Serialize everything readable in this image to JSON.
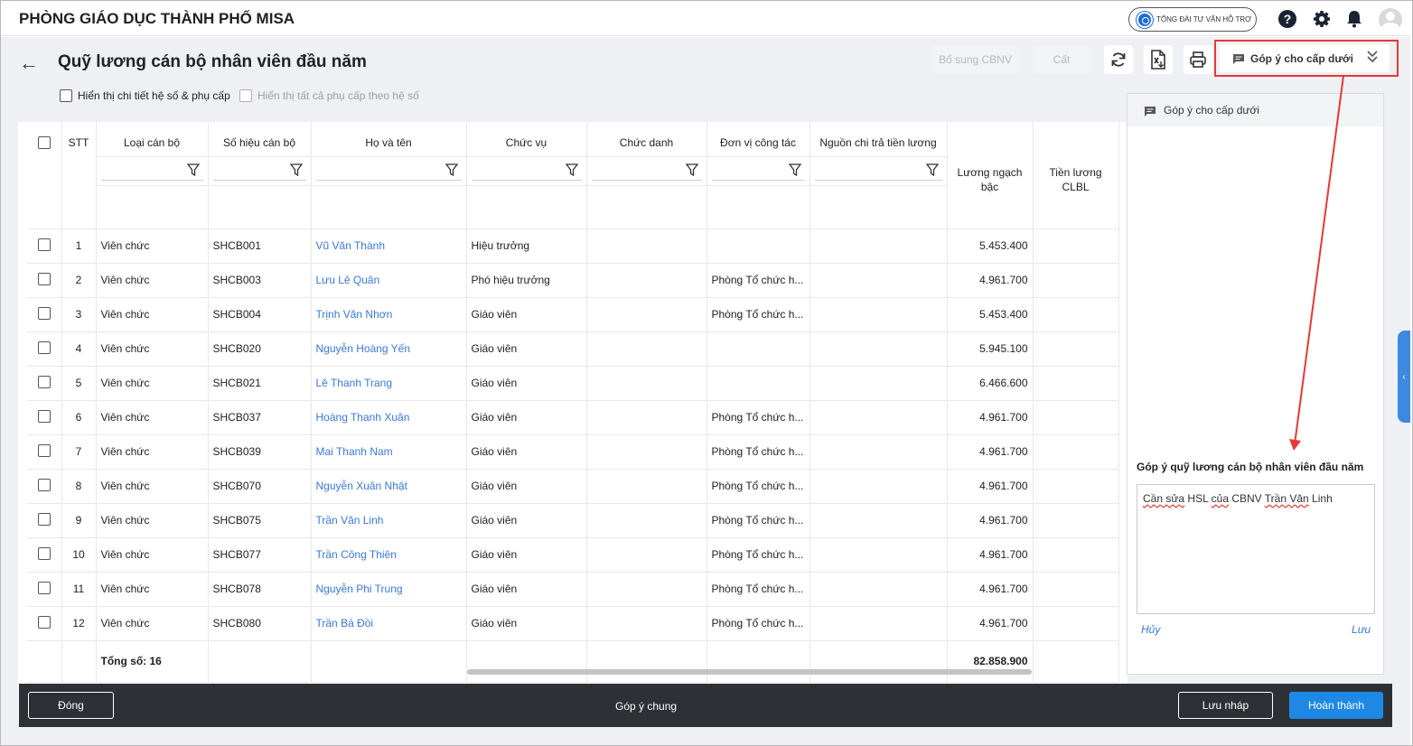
{
  "app": {
    "org_title": "PHÒNG GIÁO DỤC THÀNH PHỐ MISA",
    "support_label": "TỔNG ĐÀI TƯ VẤN HỖ TRỢ",
    "help_glyph": "?"
  },
  "page": {
    "back_glyph": "←",
    "title": "Quỹ lương cán bộ nhân viên đầu năm"
  },
  "toolbar": {
    "add_staff_label": "Bổ sung CBNV",
    "save_label": "Cất",
    "feedback_button_label": "Góp ý cho cấp dưới",
    "icons": [
      "refresh-icon",
      "excel-export-icon",
      "print-icon",
      "comment-icon",
      "double-chevron-down-icon"
    ]
  },
  "options": {
    "show_detail_label": "Hiển thị chi tiết hệ số & phụ cấp",
    "show_all_label": "Hiển thị tất cả phụ cấp theo hệ số"
  },
  "table": {
    "headers": {
      "stt": "STT",
      "type": "Loại cán bộ",
      "code": "Số hiệu cán bộ",
      "name": "Họ và tên",
      "position": "Chức vụ",
      "title": "Chức danh",
      "unit": "Đơn vị công tác",
      "source": "Nguồn chi trả tiền lương",
      "salary": "Lương ngạch bậc",
      "clbl": "Tiền lương CLBL"
    },
    "rows": [
      {
        "stt": "1",
        "type": "Viên chức",
        "code": "SHCB001",
        "name": "Vũ Văn Thành",
        "position": "Hiệu trưởng",
        "title": "",
        "unit": "",
        "source": "",
        "salary": "5.453.400"
      },
      {
        "stt": "2",
        "type": "Viên chức",
        "code": "SHCB003",
        "name": "Lưu Lê Quân",
        "position": "Phó hiệu trưởng",
        "title": "",
        "unit": "Phòng Tổ chức h...",
        "source": "",
        "salary": "4.961.700"
      },
      {
        "stt": "3",
        "type": "Viên chức",
        "code": "SHCB004",
        "name": "Trịnh Văn Nhơn",
        "position": "Giáo viên",
        "title": "",
        "unit": "Phòng Tổ chức h...",
        "source": "",
        "salary": "5.453.400"
      },
      {
        "stt": "4",
        "type": "Viên chức",
        "code": "SHCB020",
        "name": "Nguyễn Hoàng Yến",
        "position": "Giáo viên",
        "title": "",
        "unit": "",
        "source": "",
        "salary": "5.945.100"
      },
      {
        "stt": "5",
        "type": "Viên chức",
        "code": "SHCB021",
        "name": "Lê Thanh Trang",
        "position": "Giáo viên",
        "title": "",
        "unit": "",
        "source": "",
        "salary": "6.466.600"
      },
      {
        "stt": "6",
        "type": "Viên chức",
        "code": "SHCB037",
        "name": "Hoàng Thanh Xuân",
        "position": "Giáo viên",
        "title": "",
        "unit": "Phòng Tổ chức h...",
        "source": "",
        "salary": "4.961.700"
      },
      {
        "stt": "7",
        "type": "Viên chức",
        "code": "SHCB039",
        "name": "Mai Thanh Nam",
        "position": "Giáo viên",
        "title": "",
        "unit": "Phòng Tổ chức h...",
        "source": "",
        "salary": "4.961.700"
      },
      {
        "stt": "8",
        "type": "Viên chức",
        "code": "SHCB070",
        "name": "Nguyễn Xuân Nhật",
        "position": "Giáo viên",
        "title": "",
        "unit": "Phòng Tổ chức h...",
        "source": "",
        "salary": "4.961.700"
      },
      {
        "stt": "9",
        "type": "Viên chức",
        "code": "SHCB075",
        "name": "Trần Văn Linh",
        "position": "Giáo viên",
        "title": "",
        "unit": "Phòng Tổ chức h...",
        "source": "",
        "salary": "4.961.700"
      },
      {
        "stt": "10",
        "type": "Viên chức",
        "code": "SHCB077",
        "name": "Trần Công Thiên",
        "position": "Giáo viên",
        "title": "",
        "unit": "Phòng Tổ chức h...",
        "source": "",
        "salary": "4.961.700"
      },
      {
        "stt": "11",
        "type": "Viên chức",
        "code": "SHCB078",
        "name": "Nguyễn Phi Trung",
        "position": "Giáo viên",
        "title": "",
        "unit": "Phòng Tổ chức h...",
        "source": "",
        "salary": "4.961.700"
      },
      {
        "stt": "12",
        "type": "Viên chức",
        "code": "SHCB080",
        "name": "Trần Bá Đồi",
        "position": "Giáo viên",
        "title": "",
        "unit": "Phòng Tổ chức h...",
        "source": "",
        "salary": "4.961.700"
      }
    ],
    "total_label": "Tổng số: 16",
    "total_salary": "82.858.900"
  },
  "feedback_panel": {
    "menu_item_label": "Góp ý cho cấp dưới",
    "title": "Góp ý quỹ lương cán bộ nhân viên đầu năm",
    "text_words": [
      "Cần sửa",
      " HSL ",
      "của",
      " CBNV ",
      "Trần Văn",
      " Linh"
    ],
    "cancel_label": "Hủy",
    "save_label": "Lưu"
  },
  "footer": {
    "close_label": "Đóng",
    "general_feedback_label": "Góp ý chung",
    "draft_label": "Lưu nháp",
    "complete_label": "Hoàn thành"
  },
  "colors": {
    "accent": "#1e88e5",
    "link": "#3a78d6",
    "highlight": "#e53935",
    "footer_bg": "#2d3136"
  }
}
